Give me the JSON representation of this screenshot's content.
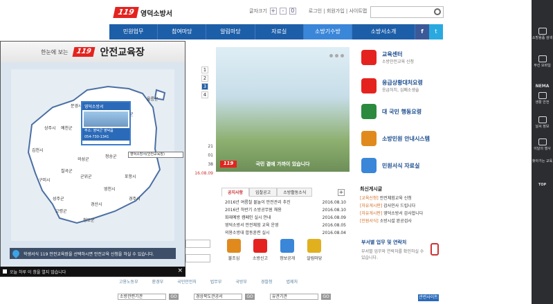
{
  "header": {
    "logo_mark": "119",
    "site_name": "영덕소방서",
    "search_placeholder": ""
  },
  "util": {
    "zoom_label": "글자크기",
    "plus": "+",
    "minus": "-",
    "reset": "0",
    "links": "로그인 | 회원가입 | 사이트맵"
  },
  "nav": {
    "items": [
      "민원업무",
      "참여마당",
      "알림마당",
      "자료실",
      "소방기수방",
      "소방서소개"
    ],
    "active_index": 4,
    "facebook": "f",
    "twitter": "t"
  },
  "hero": {
    "caption": "국민 곁에 가까이 있습니다",
    "logo": "119",
    "page_nums": [
      "1",
      "2",
      "3",
      "4"
    ],
    "active_page": 3
  },
  "quick_links": [
    {
      "title": "교육센터",
      "sub": "소방안전교육 신청",
      "color": "#e4231f"
    },
    {
      "title": "응급상황대처요령",
      "sub": "응급처치, 심폐소생술",
      "color": "#e4231f"
    },
    {
      "title": "대 국민 행동요령",
      "sub": "",
      "color": "#2b8a3e"
    },
    {
      "title": "소방민원 안내시스템",
      "sub": "",
      "color": "#e08a1e"
    },
    {
      "title": "민원서식 자료실",
      "sub": "",
      "color": "#3a86d9"
    }
  ],
  "bg_table": [
    "21",
    "01",
    "38"
  ],
  "bg_date": "16.08.09",
  "news": {
    "tabs": [
      "공지사항",
      "입찰공고",
      "소방활동소식"
    ],
    "active_tab": 0,
    "more": "+",
    "rows": [
      {
        "title": "2016년 여름철 물놀이 안전관리 추진",
        "date": "2016.08.10"
      },
      {
        "title": "2016년 하반기 소방공무원 채용",
        "date": "2016.08.10"
      },
      {
        "title": "화재예방 캠페인 실시 안내",
        "date": "2016.08.09"
      },
      {
        "title": "영덕소방서 안전체험 교육 운영",
        "date": "2016.08.05"
      },
      {
        "title": "의용소방대 합동훈련 실시",
        "date": "2016.08.04"
      }
    ]
  },
  "latest": {
    "heading": "최신게시글",
    "rows": [
      {
        "tag": "[교육신청]",
        "text": "안전체험교육 신청"
      },
      {
        "tag": "[자유게시판]",
        "text": "감사인사 드립니다"
      },
      {
        "tag": "[자유게시판]",
        "text": "영덕소방서 감사합니다"
      },
      {
        "tag": "[민원서식]",
        "text": "소방시설 완공검사"
      }
    ]
  },
  "services": [
    {
      "label": "불조심",
      "color": "#e08a1e"
    },
    {
      "label": "소방신고",
      "color": "#e4231f"
    },
    {
      "label": "정보공개",
      "color": "#3a86d9"
    },
    {
      "label": "알림마당",
      "color": "#e0b01e"
    }
  ],
  "contact": {
    "title": "부서별 업무 및 연락처",
    "sub": "부서별 업무와 연락처를 확인하실 수 있습니다."
  },
  "partners": [
    "고용노동부",
    "환경부",
    "국민안전처",
    "법무부",
    "국방부",
    "경찰청",
    "법제처"
  ],
  "selects": [
    {
      "value": "소방관련기관",
      "go": "GO"
    },
    {
      "value": "경상북도관공서",
      "go": "GO"
    },
    {
      "value": "유관기관",
      "go": "GO"
    }
  ],
  "to_top": "관련사이트",
  "sidebar": [
    {
      "label": "소방용품 검색"
    },
    {
      "label": "무선 모바일"
    },
    {
      "label": "NEMA"
    },
    {
      "label": "생활 안전"
    },
    {
      "label": "날씨 정보"
    },
    {
      "label": "이달의 행사"
    },
    {
      "label": "찾아가는 교육"
    },
    {
      "label": "TOP"
    }
  ],
  "popup": {
    "pre": "한눈에 보는",
    "mark": "119",
    "title": "안전교육장",
    "regions": [
      "울진군",
      "영주시",
      "봉화군",
      "안동시",
      "영양군",
      "영덕군",
      "상주시",
      "의성군",
      "청송군",
      "포항시",
      "구미시",
      "군위군",
      "영천시",
      "경주시",
      "칠곡군",
      "고령군",
      "성주군",
      "경산시",
      "청도군",
      "울릉군",
      "문경시",
      "예천군",
      "김천시"
    ],
    "tip": {
      "heading": "영덕소방서",
      "address": "주소: 영덕군 영덕읍",
      "phone": "054-730-1341"
    },
    "tip2": "영덕소방서(안전교육장)",
    "notice": "학생서식 119 안전교육장을 선택하시면 안전교육 신청을 하실 수 있습니다.",
    "footer": "오늘 하루 이 창을 열지 않습니다",
    "close": "×"
  }
}
